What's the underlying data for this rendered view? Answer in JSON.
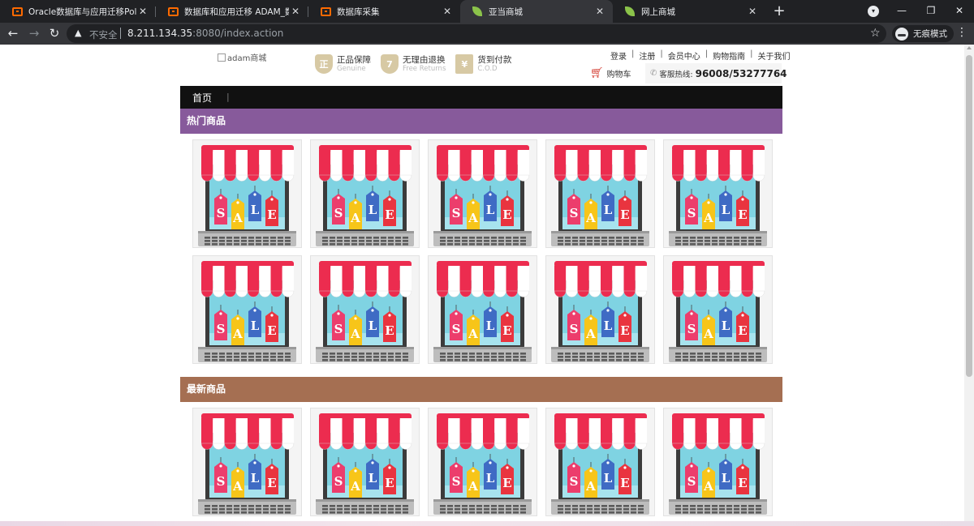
{
  "browser": {
    "tabs": [
      {
        "title": "Oracle数据库与应用迁移PolarDB",
        "icon": "aliyun-icon",
        "active": false
      },
      {
        "title": "数据库和应用迁移 ADAM_数据库",
        "icon": "aliyun-icon",
        "active": false
      },
      {
        "title": "数据库采集",
        "icon": "aliyun-icon",
        "active": false
      },
      {
        "title": "亚当商城",
        "icon": "leaf-icon",
        "active": true
      },
      {
        "title": "网上商城",
        "icon": "leaf-icon",
        "active": false
      }
    ],
    "close_glyph": "✕",
    "new_tab_glyph": "+",
    "security_label": "不安全",
    "url_host": "8.211.134.35",
    "url_rest": ":8080/index.action",
    "incognito_label": "无痕模式"
  },
  "site": {
    "logo_alt": "adam商城",
    "promises": [
      {
        "icon_char": "正",
        "title": "正品保障",
        "subtitle": "Genuine"
      },
      {
        "icon_char": "7",
        "title": "无理由退换",
        "subtitle": "Free Returns"
      },
      {
        "icon_char": "¥",
        "title": "货到付款",
        "subtitle": "C.O.D"
      }
    ],
    "top_links": [
      "登录",
      "注册",
      "会员中心",
      "购物指南",
      "关于我们"
    ],
    "cart_label": "购物车",
    "hotline_label": "客服热线:",
    "hotline_number": "96008/53277764",
    "nav": {
      "home": "首页",
      "separator": "|"
    }
  },
  "sections": {
    "hot": {
      "title": "热门商品",
      "item_count": 10
    },
    "new": {
      "title": "最新商品",
      "item_count": 5
    }
  },
  "product_image": {
    "sale_letters": [
      "S",
      "A",
      "L",
      "E"
    ]
  },
  "colors": {
    "hot_bar": "#875a9b",
    "new_bar": "#a56f52",
    "nav_bar": "#111111",
    "awning_red": "#ec2c4f"
  }
}
